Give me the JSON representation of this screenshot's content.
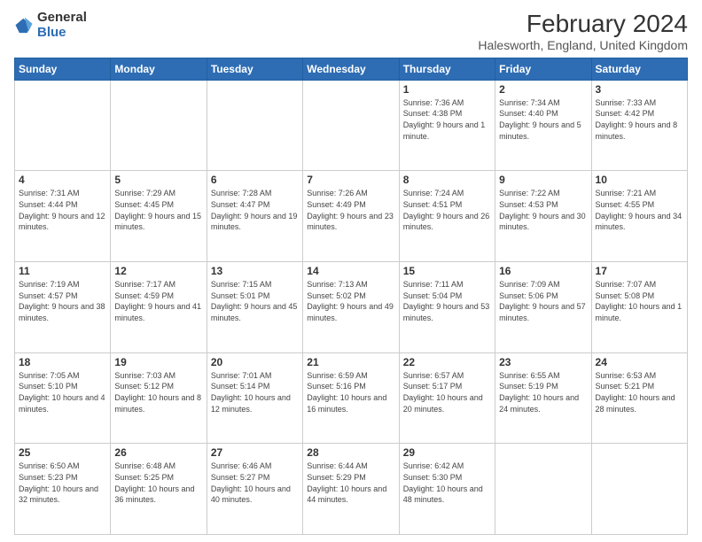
{
  "header": {
    "logo_general": "General",
    "logo_blue": "Blue",
    "main_title": "February 2024",
    "subtitle": "Halesworth, England, United Kingdom"
  },
  "calendar": {
    "days_of_week": [
      "Sunday",
      "Monday",
      "Tuesday",
      "Wednesday",
      "Thursday",
      "Friday",
      "Saturday"
    ],
    "weeks": [
      [
        {
          "day": "",
          "info": ""
        },
        {
          "day": "",
          "info": ""
        },
        {
          "day": "",
          "info": ""
        },
        {
          "day": "",
          "info": ""
        },
        {
          "day": "1",
          "info": "Sunrise: 7:36 AM\nSunset: 4:38 PM\nDaylight: 9 hours and 1 minute."
        },
        {
          "day": "2",
          "info": "Sunrise: 7:34 AM\nSunset: 4:40 PM\nDaylight: 9 hours and 5 minutes."
        },
        {
          "day": "3",
          "info": "Sunrise: 7:33 AM\nSunset: 4:42 PM\nDaylight: 9 hours and 8 minutes."
        }
      ],
      [
        {
          "day": "4",
          "info": "Sunrise: 7:31 AM\nSunset: 4:44 PM\nDaylight: 9 hours and 12 minutes."
        },
        {
          "day": "5",
          "info": "Sunrise: 7:29 AM\nSunset: 4:45 PM\nDaylight: 9 hours and 15 minutes."
        },
        {
          "day": "6",
          "info": "Sunrise: 7:28 AM\nSunset: 4:47 PM\nDaylight: 9 hours and 19 minutes."
        },
        {
          "day": "7",
          "info": "Sunrise: 7:26 AM\nSunset: 4:49 PM\nDaylight: 9 hours and 23 minutes."
        },
        {
          "day": "8",
          "info": "Sunrise: 7:24 AM\nSunset: 4:51 PM\nDaylight: 9 hours and 26 minutes."
        },
        {
          "day": "9",
          "info": "Sunrise: 7:22 AM\nSunset: 4:53 PM\nDaylight: 9 hours and 30 minutes."
        },
        {
          "day": "10",
          "info": "Sunrise: 7:21 AM\nSunset: 4:55 PM\nDaylight: 9 hours and 34 minutes."
        }
      ],
      [
        {
          "day": "11",
          "info": "Sunrise: 7:19 AM\nSunset: 4:57 PM\nDaylight: 9 hours and 38 minutes."
        },
        {
          "day": "12",
          "info": "Sunrise: 7:17 AM\nSunset: 4:59 PM\nDaylight: 9 hours and 41 minutes."
        },
        {
          "day": "13",
          "info": "Sunrise: 7:15 AM\nSunset: 5:01 PM\nDaylight: 9 hours and 45 minutes."
        },
        {
          "day": "14",
          "info": "Sunrise: 7:13 AM\nSunset: 5:02 PM\nDaylight: 9 hours and 49 minutes."
        },
        {
          "day": "15",
          "info": "Sunrise: 7:11 AM\nSunset: 5:04 PM\nDaylight: 9 hours and 53 minutes."
        },
        {
          "day": "16",
          "info": "Sunrise: 7:09 AM\nSunset: 5:06 PM\nDaylight: 9 hours and 57 minutes."
        },
        {
          "day": "17",
          "info": "Sunrise: 7:07 AM\nSunset: 5:08 PM\nDaylight: 10 hours and 1 minute."
        }
      ],
      [
        {
          "day": "18",
          "info": "Sunrise: 7:05 AM\nSunset: 5:10 PM\nDaylight: 10 hours and 4 minutes."
        },
        {
          "day": "19",
          "info": "Sunrise: 7:03 AM\nSunset: 5:12 PM\nDaylight: 10 hours and 8 minutes."
        },
        {
          "day": "20",
          "info": "Sunrise: 7:01 AM\nSunset: 5:14 PM\nDaylight: 10 hours and 12 minutes."
        },
        {
          "day": "21",
          "info": "Sunrise: 6:59 AM\nSunset: 5:16 PM\nDaylight: 10 hours and 16 minutes."
        },
        {
          "day": "22",
          "info": "Sunrise: 6:57 AM\nSunset: 5:17 PM\nDaylight: 10 hours and 20 minutes."
        },
        {
          "day": "23",
          "info": "Sunrise: 6:55 AM\nSunset: 5:19 PM\nDaylight: 10 hours and 24 minutes."
        },
        {
          "day": "24",
          "info": "Sunrise: 6:53 AM\nSunset: 5:21 PM\nDaylight: 10 hours and 28 minutes."
        }
      ],
      [
        {
          "day": "25",
          "info": "Sunrise: 6:50 AM\nSunset: 5:23 PM\nDaylight: 10 hours and 32 minutes."
        },
        {
          "day": "26",
          "info": "Sunrise: 6:48 AM\nSunset: 5:25 PM\nDaylight: 10 hours and 36 minutes."
        },
        {
          "day": "27",
          "info": "Sunrise: 6:46 AM\nSunset: 5:27 PM\nDaylight: 10 hours and 40 minutes."
        },
        {
          "day": "28",
          "info": "Sunrise: 6:44 AM\nSunset: 5:29 PM\nDaylight: 10 hours and 44 minutes."
        },
        {
          "day": "29",
          "info": "Sunrise: 6:42 AM\nSunset: 5:30 PM\nDaylight: 10 hours and 48 minutes."
        },
        {
          "day": "",
          "info": ""
        },
        {
          "day": "",
          "info": ""
        }
      ]
    ]
  }
}
